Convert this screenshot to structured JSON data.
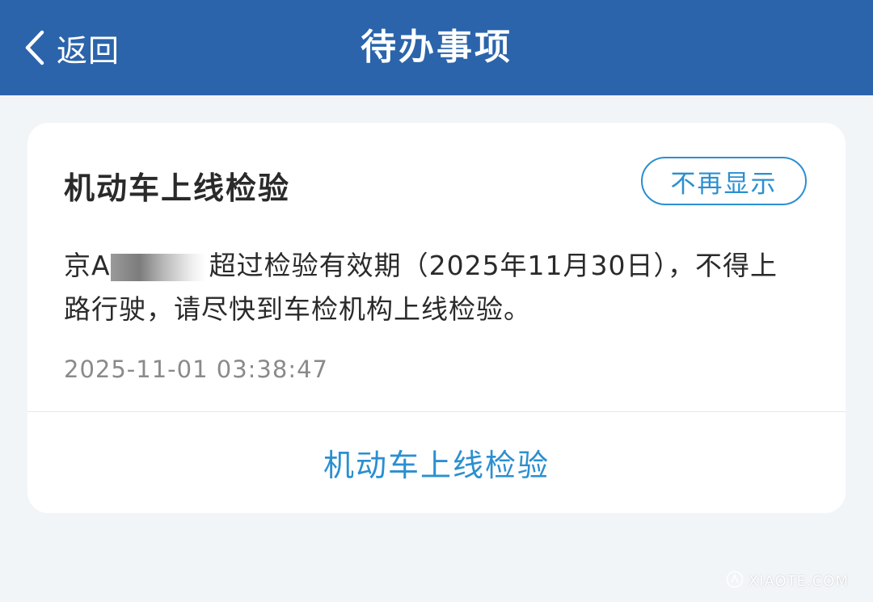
{
  "header": {
    "back_label": "返回",
    "title": "待办事项"
  },
  "card": {
    "title": "机动车上线检验",
    "dismiss_label": "不再显示",
    "plate_visible": "京A",
    "message_rest": "超过检验有效期（2025年11月30日），不得上路行驶，请尽快到车检机构上线检验。",
    "timestamp": "2025-11-01 03:38:47",
    "action_label": "机动车上线检验"
  },
  "watermark": {
    "text": "XIAOTE.COM"
  },
  "colors": {
    "header_bg": "#2b64ab",
    "accent": "#2b8fd0",
    "page_bg": "#f2f5f8"
  },
  "icons": {
    "back": "chevron-left-icon",
    "watermark": "logo-icon"
  }
}
